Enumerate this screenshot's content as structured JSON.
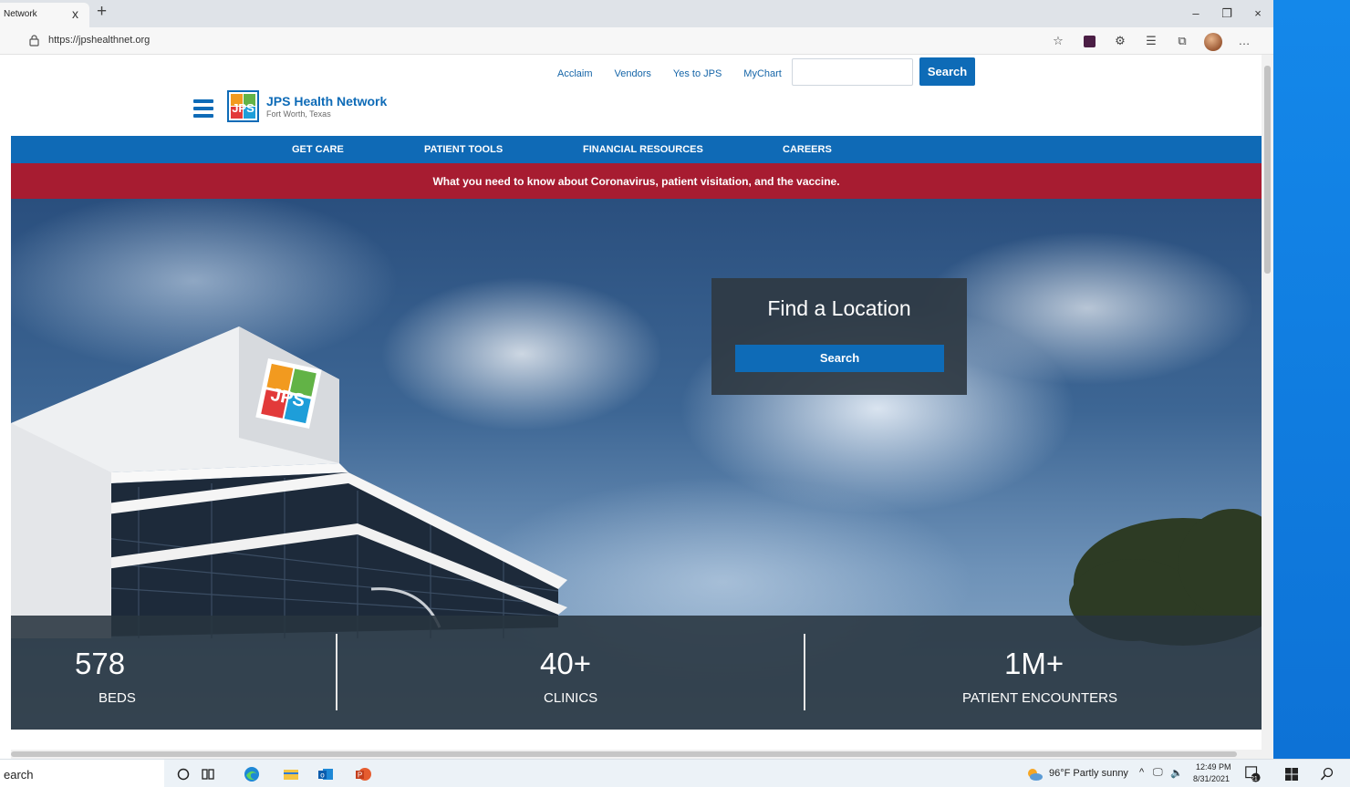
{
  "browser": {
    "tab_title": "Network",
    "tab_close": "x",
    "new_tab": "+",
    "url": "https://jpshealthnet.org",
    "window_controls": [
      "–",
      "❐",
      "×"
    ],
    "more_label": "…"
  },
  "site": {
    "utility_links": [
      "Acclaim",
      "Vendors",
      "Yes to JPS",
      "MyChart"
    ],
    "search_button": "Search",
    "search_value": "",
    "logo_name": "JPS Health Network",
    "logo_sub": "Fort Worth, Texas",
    "main_nav": [
      "GET CARE",
      "PATIENT TOOLS",
      "FINANCIAL RESOURCES",
      "CAREERS"
    ],
    "alert_text": "What you need to know about Coronavirus, patient visitation, and the vaccine.",
    "find_location": {
      "title": "Find a Location",
      "button": "Search"
    },
    "stats": [
      {
        "number": "578",
        "label": "BEDS"
      },
      {
        "number": "40+",
        "label": "CLINICS"
      },
      {
        "number": "1M+",
        "label": "PATIENT ENCOUNTERS"
      }
    ],
    "brand_colors": {
      "primary_blue": "#0f6ab6",
      "alert_red": "#a71c31",
      "overlay_dark": "#2f3a44"
    }
  },
  "taskbar": {
    "search_text": "earch",
    "weather": "96°F  Partly sunny",
    "time": "12:49 PM",
    "date": "8/31/2021",
    "notifications": "21"
  },
  "icons": [
    "lock-icon",
    "favorites-star-icon",
    "extension-icon",
    "extensions-puzzle-icon",
    "favorites-list-icon",
    "collections-icon",
    "profile-avatar-icon",
    "more-icon",
    "hamburger-menu-icon",
    "jps-logo-icon",
    "cortana-icon",
    "task-view-icon",
    "edge-icon",
    "file-explorer-icon",
    "outlook-icon",
    "powerpoint-icon",
    "weather-icon",
    "windows-start-icon"
  ]
}
